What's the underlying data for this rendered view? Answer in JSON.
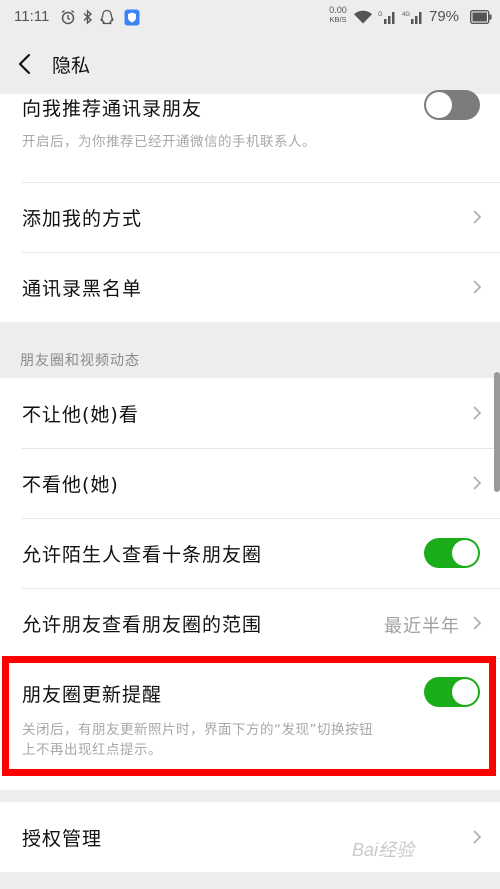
{
  "status_bar": {
    "time": "11:11",
    "net_speed_value": "0.00",
    "net_speed_unit": "KB/S",
    "battery_percent": "79%"
  },
  "nav": {
    "title": "隐私"
  },
  "top_group": {
    "recommend_contacts": {
      "label": "向我推荐通讯录朋友",
      "description": "开启后，为你推荐已经开通微信的手机联系人。",
      "enabled": false
    },
    "add_me_methods": {
      "label": "添加我的方式"
    },
    "contacts_blacklist": {
      "label": "通讯录黑名单"
    }
  },
  "moments_section": {
    "header": "朋友圈和视频动态",
    "dont_let_see": {
      "label": "不让他(她)看"
    },
    "dont_see": {
      "label": "不看他(她)"
    },
    "strangers_ten_posts": {
      "label": "允许陌生人查看十条朋友圈",
      "enabled": true
    },
    "visible_range": {
      "label": "允许朋友查看朋友圈的范围",
      "value": "最近半年"
    },
    "update_reminder": {
      "label": "朋友圈更新提醒",
      "enabled": true,
      "description_line1": "关闭后，有朋友更新照片时，界面下方的“发现”切换按钮",
      "description_line2": "上不再出现红点提示。"
    }
  },
  "bottom_group": {
    "authorization": {
      "label": "授权管理"
    }
  },
  "watermark_text": "Bai经验",
  "colors": {
    "toggle_on": "#1aad19",
    "toggle_off": "#7c7c7c",
    "highlight": "#ff0000"
  }
}
